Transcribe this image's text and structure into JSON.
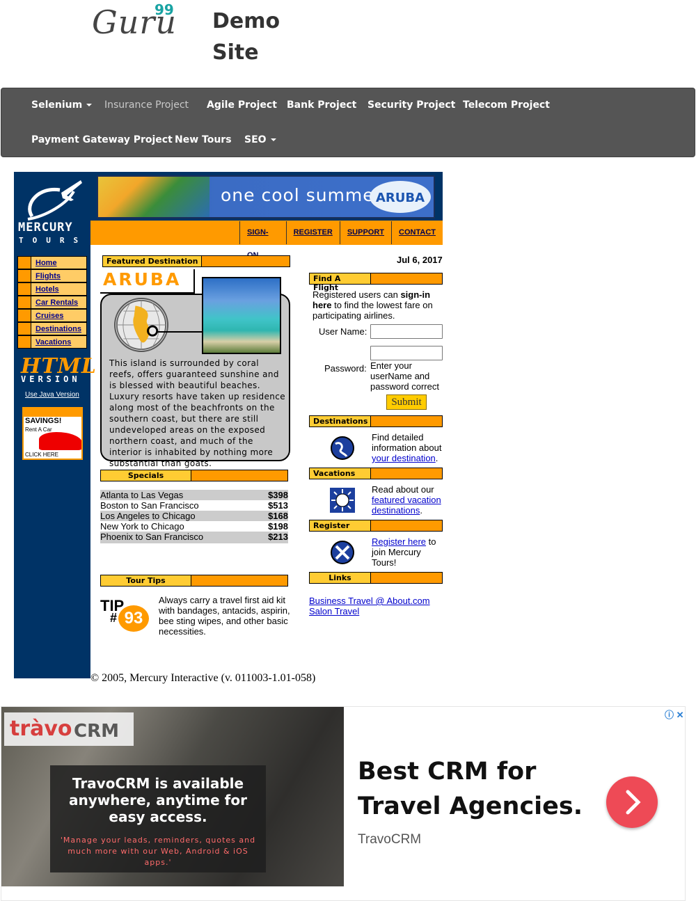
{
  "brand": {
    "logo": "Guru",
    "logo_sup": "99",
    "site_title_1": "Demo",
    "site_title_2": "Site"
  },
  "nav": {
    "items": [
      {
        "label": "Selenium",
        "dropdown": true
      },
      {
        "label": "Insurance Project",
        "dropdown": false
      },
      {
        "label": "Agile Project",
        "dropdown": false
      },
      {
        "label": "Bank Project",
        "dropdown": false
      },
      {
        "label": "Security Project",
        "dropdown": false
      },
      {
        "label": "Telecom Project",
        "dropdown": false
      },
      {
        "label": "Payment Gateway Project",
        "dropdown": false
      },
      {
        "label": "New Tours",
        "dropdown": false
      },
      {
        "label": "SEO",
        "dropdown": true
      }
    ]
  },
  "mercury": {
    "logo_top": "MERCURY",
    "logo_bottom": "TOURS",
    "banner_text": "one cool summer",
    "banner_badge": "ARUBA",
    "top_links": [
      "SIGN-ON",
      "REGISTER",
      "SUPPORT",
      "CONTACT"
    ],
    "left_menu": [
      "Home",
      "Flights",
      "Hotels",
      "Car Rentals",
      "Cruises",
      "Destinations",
      "Vacations"
    ],
    "html_version_1": "HTML",
    "html_version_2": "VERSION",
    "java_link": "Use Java Version",
    "savings_1": "SAVINGS!",
    "savings_2": "Rent A Car",
    "savings_3": "CLICK HERE"
  },
  "featured": {
    "header": "Featured Destination",
    "title": "ARUBA",
    "text": "This island is surrounded by coral reefs, offers guaranteed sunshine and is blessed with beautiful beaches. Luxury resorts have taken up residence along most of the beachfronts on the southern coast, but there are still undeveloped areas on the exposed northern coast, and much of the interior is inhabited by nothing more substantial than goats."
  },
  "specials": {
    "header": "Specials",
    "rows": [
      {
        "route": "Atlanta to Las Vegas",
        "price": "$398"
      },
      {
        "route": "Boston to San Francisco",
        "price": "$513"
      },
      {
        "route": "Los Angeles to Chicago",
        "price": "$168"
      },
      {
        "route": "New York to Chicago",
        "price": "$198"
      },
      {
        "route": "Phoenix to San Francisco",
        "price": "$213"
      }
    ]
  },
  "tour_tips": {
    "header": "Tour Tips",
    "tip_label": "TIP",
    "tip_hash": "#",
    "tip_number": "93",
    "text": "Always carry a travel first aid kit with bandages, antacids, aspirin, bee sting wipes, and other basic necessities."
  },
  "copyright": "© 2005, Mercury Interactive (v. 011003-1.01-058)",
  "right": {
    "date": "Jul 6, 2017",
    "find_flight_header": "Find A Flight",
    "intro_1": "Registered users can ",
    "intro_bold": "sign-in here",
    "intro_2": " to find the lowest fare on participating airlines.",
    "username_label": "User Name:",
    "password_label": "Password:",
    "username_value": "",
    "password_value": "",
    "password_hint": "Enter your userName and password correct",
    "submit": "Submit",
    "destinations_header": "Destinations",
    "destinations_text": "Find detailed information about ",
    "destinations_link": "your destination",
    "destinations_end": ".",
    "vacations_header": "Vacations",
    "vacations_text": "Read about our ",
    "vacations_link": "featured vacation destinations",
    "vacations_end": ".",
    "register_header": "Register",
    "register_link": "Register here",
    "register_text": " to join Mercury Tours!",
    "links_header": "Links",
    "links": [
      "Business Travel @ About.com",
      "Salon Travel"
    ]
  },
  "ad": {
    "logo_a": "tràvo",
    "logo_b": "CRM",
    "overlay_headline": "TravoCRM is available anywhere, anytime for easy access.",
    "overlay_sub": "'Manage your leads, reminders, quotes and much more with our Web, Android & iOS apps.'",
    "headline": "Best CRM for Travel Agencies.",
    "brand": "TravoCRM",
    "choices": "ⓘ ✕"
  }
}
